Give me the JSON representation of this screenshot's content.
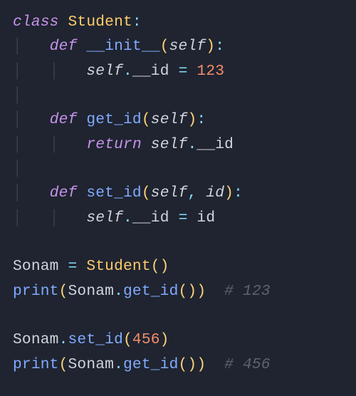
{
  "code": {
    "kw_class": "class",
    "cls_name": "Student",
    "colon": ":",
    "kw_def": "def",
    "fn_init": "__init__",
    "self": "self",
    "fn_get": "get_id",
    "fn_set": "set_id",
    "param_id": "id",
    "kw_return": "return",
    "attr_id": "__id",
    "eq": "=",
    "dot": ".",
    "lpar": "(",
    "rpar": ")",
    "comma": ",",
    "num_123": "123",
    "num_456": "456",
    "var_sonam": "Sonam",
    "fn_print": "print",
    "cmt_123": "# 123",
    "cmt_456": "# 456",
    "guide": "│",
    "sp1": " ",
    "sp2": "  ",
    "sp4": "    "
  }
}
